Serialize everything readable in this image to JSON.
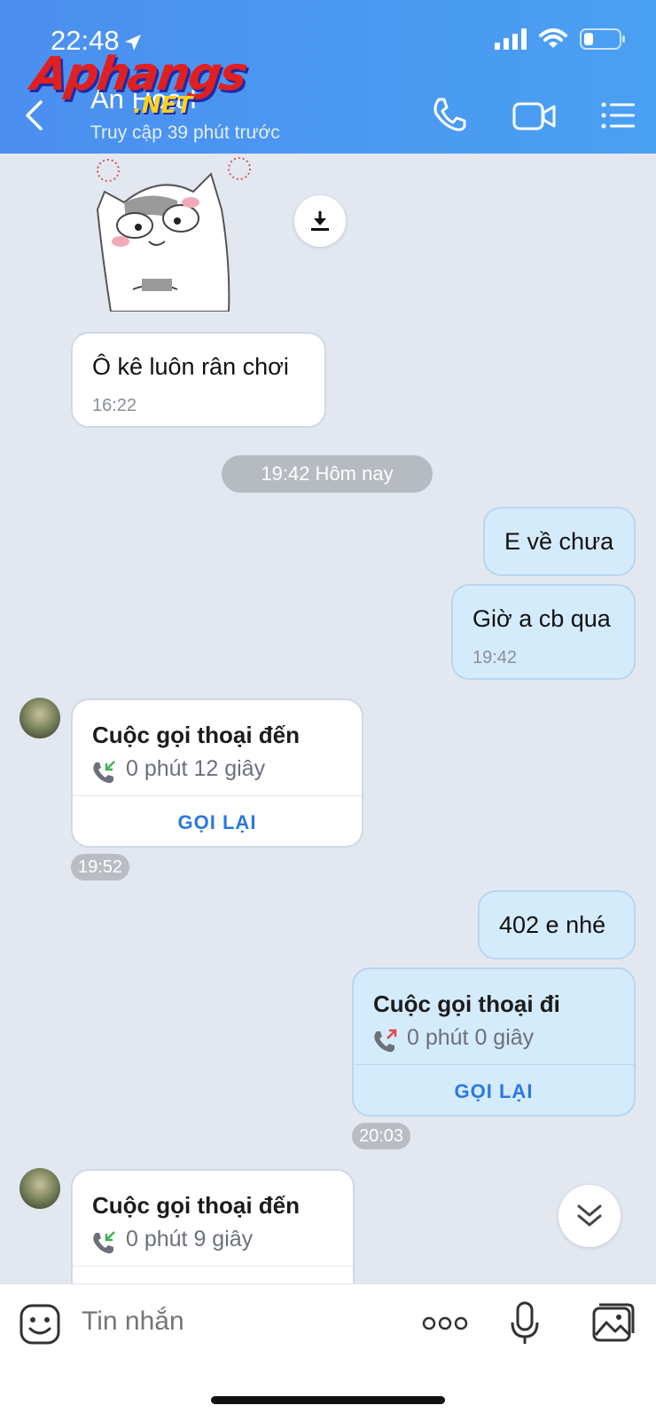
{
  "status_bar": {
    "time": "22:48"
  },
  "watermark": {
    "brand": "Aphangs",
    "suffix": ".NET"
  },
  "header": {
    "contact_name": "An Hoa P",
    "contact_status": "Truy cập 39 phút trước"
  },
  "messages": [
    {
      "type": "text",
      "dir": "in",
      "text": "Ô kê luôn rân chơi",
      "time": "16:22"
    },
    {
      "type": "date",
      "label": "19:42 Hôm nay"
    },
    {
      "type": "text",
      "dir": "out",
      "text": "E về chưa"
    },
    {
      "type": "text",
      "dir": "out",
      "text": "Giờ a cb qua",
      "time": "19:42"
    },
    {
      "type": "call",
      "dir": "in",
      "title": "Cuộc gọi thoại đến",
      "duration": "0 phút 12 giây",
      "action": "GỌI LẠI",
      "time": "19:52"
    },
    {
      "type": "text",
      "dir": "out",
      "text": "402 e nhé"
    },
    {
      "type": "call",
      "dir": "out",
      "title": "Cuộc gọi thoại đi",
      "duration": "0 phút 0 giây",
      "action": "GỌI LẠI",
      "time": "20:03"
    },
    {
      "type": "call",
      "dir": "in",
      "title": "Cuộc gọi thoại đến",
      "duration": "0 phút 9 giây"
    }
  ],
  "composer": {
    "placeholder": "Tin nhắn"
  },
  "colors": {
    "header": "#4b8ff0",
    "outgoing_bubble": "#d4ebfb",
    "background": "#e3e7ef",
    "accent": "#2a78e0"
  }
}
